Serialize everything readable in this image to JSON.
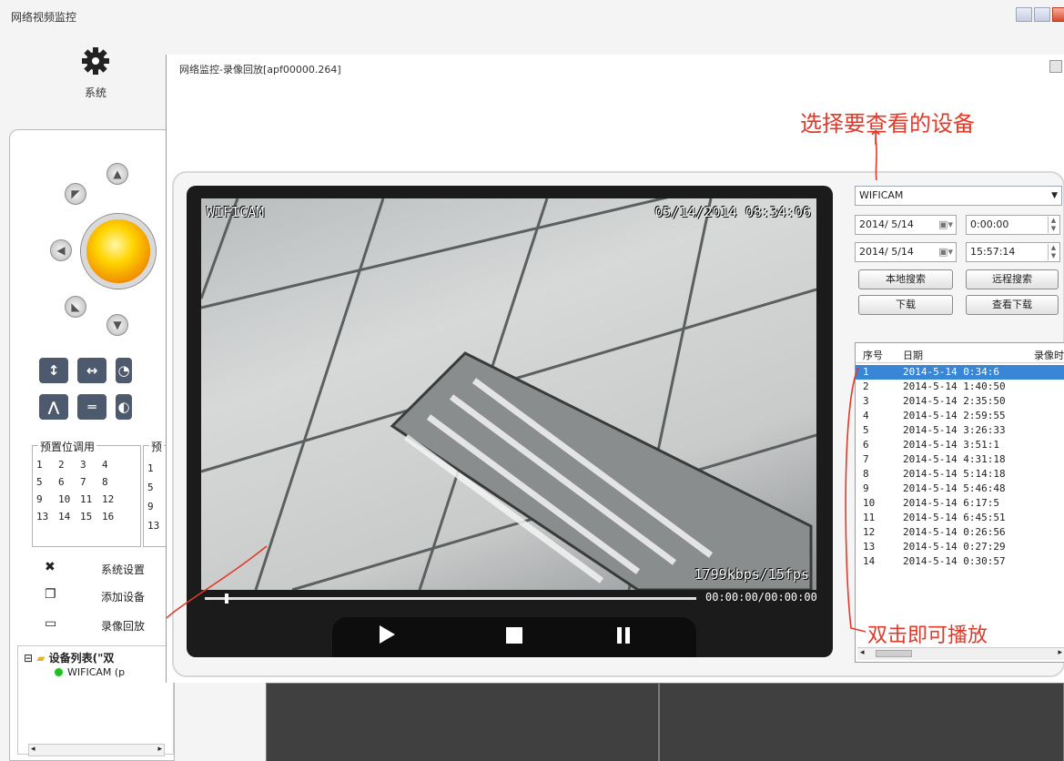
{
  "app": {
    "title": "网络视频监控",
    "system_button_label": "系统"
  },
  "ptz": {
    "presets_label": "预置位调用",
    "presets": [
      "1",
      "2",
      "3",
      "4",
      "5",
      "6",
      "7",
      "8",
      "9",
      "10",
      "11",
      "12",
      "13",
      "14",
      "15",
      "16"
    ],
    "presets2_label": "预",
    "presets2": [
      "1",
      "5",
      "9",
      "13"
    ]
  },
  "menu": [
    {
      "label": "系统设置",
      "icon": "tools-icon"
    },
    {
      "label": "添加设备",
      "icon": "add-device-icon"
    },
    {
      "label": "录像回放",
      "icon": "tv-icon"
    }
  ],
  "tree": {
    "root_label": "设备列表(\"双",
    "device_label": "WIFICAM (p"
  },
  "dialog": {
    "title": "网络监控-录像回放[apf00000.264]"
  },
  "annotations": {
    "select_device": "选择要查看的设备",
    "double_click": "双击即可播放",
    "arrow_glyph": "↑"
  },
  "player": {
    "osd_name": "WIFICAM",
    "osd_datetime": "05/14/2014 08:34:06",
    "osd_bitrate": "1799kbps/15fps",
    "time_display": "00:00:00/00:00:00",
    "progress_fraction": 0.04
  },
  "search": {
    "device": "WIFICAM",
    "start_date": "2014/ 5/14",
    "start_time": "0:00:00",
    "end_date": "2014/ 5/14",
    "end_time": "15:57:14",
    "local_search": "本地搜索",
    "remote_search": "远程搜索",
    "download": "下载",
    "view_download": "查看下载"
  },
  "records": {
    "headers": [
      "序号",
      "日期",
      "录像时"
    ],
    "rows": [
      [
        "1",
        "2014-5-14 0:34:6"
      ],
      [
        "2",
        "2014-5-14 1:40:50"
      ],
      [
        "3",
        "2014-5-14 2:35:50"
      ],
      [
        "4",
        "2014-5-14 2:59:55"
      ],
      [
        "5",
        "2014-5-14 3:26:33"
      ],
      [
        "6",
        "2014-5-14 3:51:1"
      ],
      [
        "7",
        "2014-5-14 4:31:18"
      ],
      [
        "8",
        "2014-5-14 5:14:18"
      ],
      [
        "9",
        "2014-5-14 5:46:48"
      ],
      [
        "10",
        "2014-5-14 6:17:5"
      ],
      [
        "11",
        "2014-5-14 6:45:51"
      ],
      [
        "12",
        "2014-5-14 0:26:56"
      ],
      [
        "13",
        "2014-5-14 0:27:29"
      ],
      [
        "14",
        "2014-5-14 0:30:57"
      ]
    ],
    "selected_index": 0
  },
  "colors": {
    "accent_selection": "#3a86d6",
    "annotation_red": "#e03a2b",
    "online_green": "#19c31e"
  }
}
